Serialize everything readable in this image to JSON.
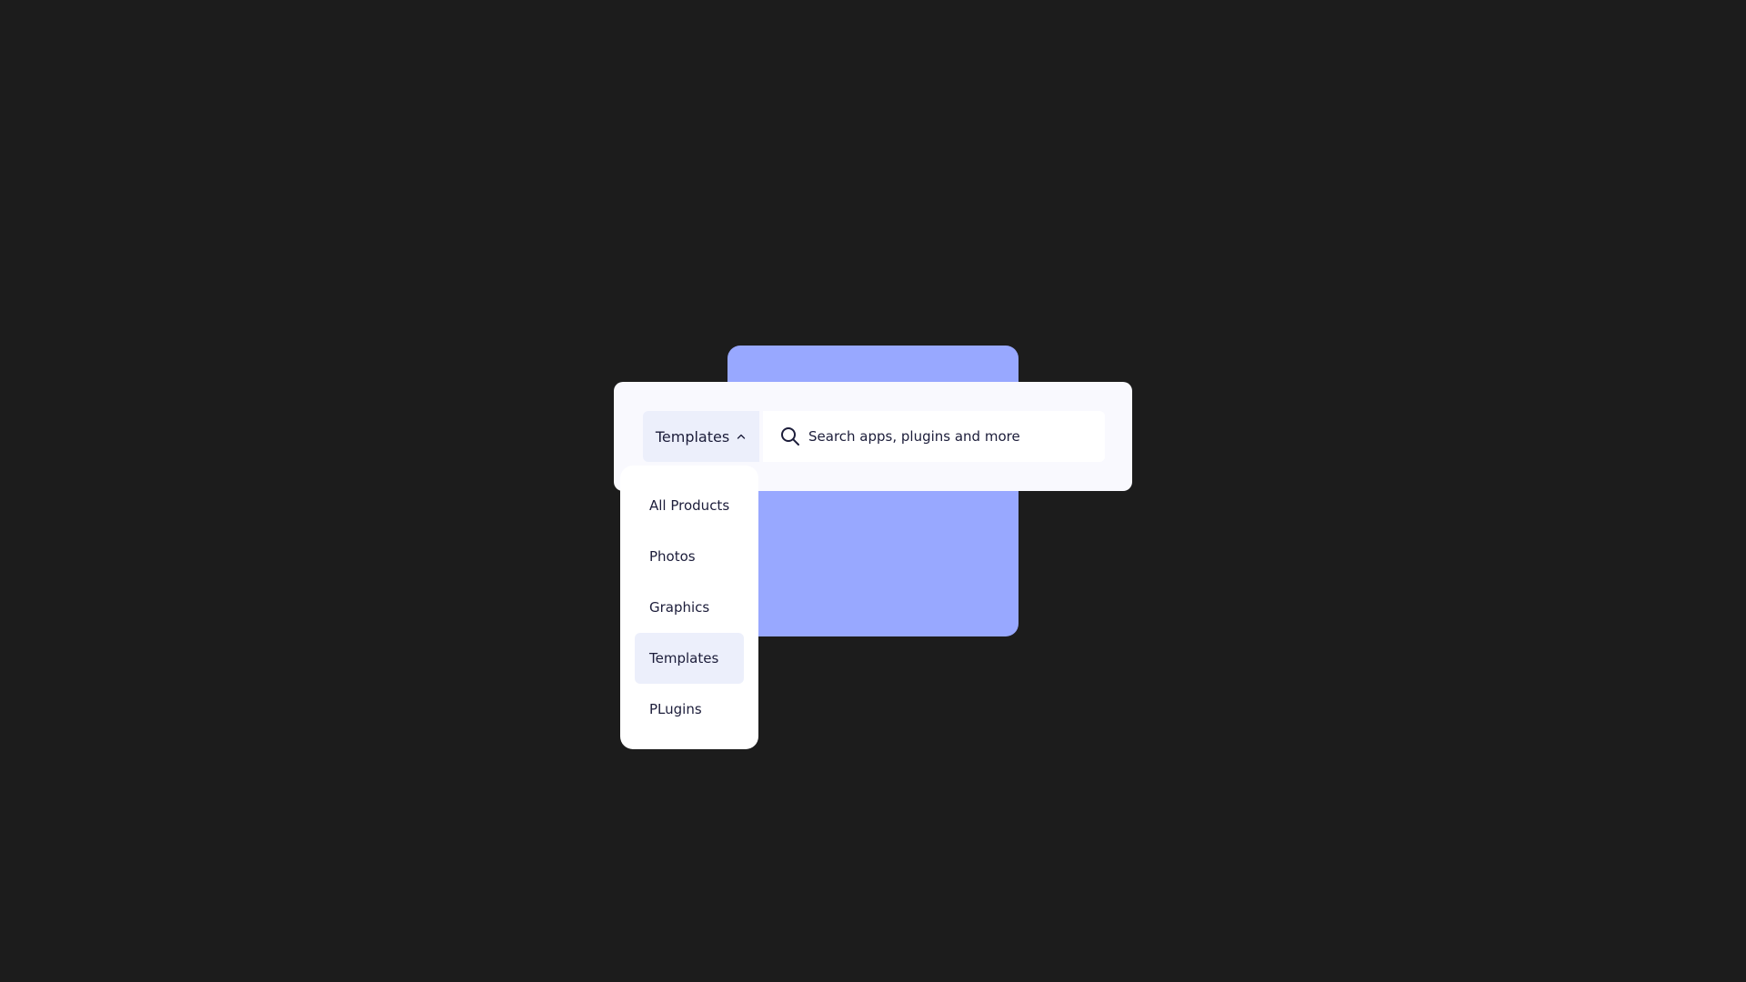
{
  "category_select": {
    "selected_label": "Templates",
    "options": [
      {
        "label": "All Products",
        "selected": false
      },
      {
        "label": "Photos",
        "selected": false
      },
      {
        "label": "Graphics",
        "selected": false
      },
      {
        "label": "Templates",
        "selected": true
      },
      {
        "label": "PLugins",
        "selected": false
      }
    ],
    "icon": "chevron-up-icon"
  },
  "search": {
    "placeholder": "Search apps, plugins and more",
    "icon": "search-icon"
  },
  "colors": {
    "page_background": "#1c1c1c",
    "accent_card": "#98a8ff",
    "panel": "#f9f9fe",
    "selected_highlight": "#eceffb",
    "text": "#1c1d3a"
  }
}
